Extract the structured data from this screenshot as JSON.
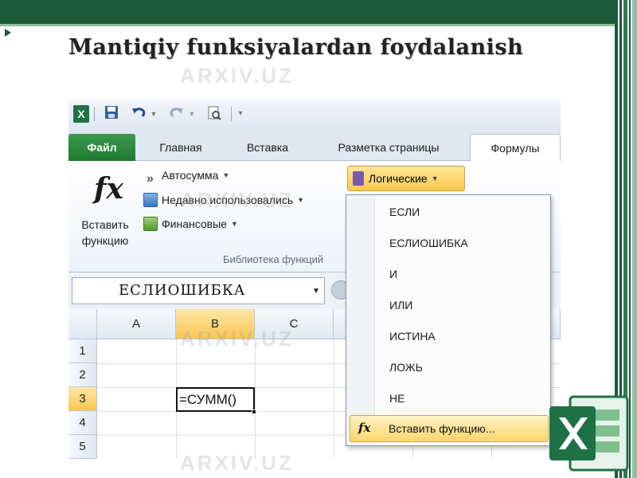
{
  "slide": {
    "title": "Mantiqiy funksiyalardan foydalanish"
  },
  "qat": {
    "logo_letter": "X",
    "icons": [
      "excel-logo-icon",
      "save-icon",
      "undo-icon",
      "redo-icon",
      "print-preview-icon",
      "customize-qat-icon"
    ]
  },
  "tabs": [
    "Файл",
    "Главная",
    "Вставка",
    "Разметка страницы",
    "Формулы"
  ],
  "ribbon": {
    "insert_function_line1": "Вставить",
    "insert_function_line2": "функцию",
    "fx_symbol": "fx",
    "autosum": "Автосумма",
    "recently_used": "Недавно использовались",
    "financial": "Финансовые",
    "logical": "Логические",
    "group_label": "Библиотека функций"
  },
  "formula_bar": {
    "name_box": "ЕСЛИОШИБКА"
  },
  "grid": {
    "columns": [
      "A",
      "B",
      "C"
    ],
    "rows": [
      "1",
      "2",
      "3",
      "4",
      "5"
    ],
    "selected_column": "B",
    "selected_row": "3",
    "active_cell_value": "=СУММ()"
  },
  "dropdown": {
    "items": [
      "ЕСЛИ",
      "ЕСЛИОШИБКА",
      "И",
      "ИЛИ",
      "ИСТИНА",
      "ЛОЖЬ",
      "НЕ"
    ],
    "insert_function": "Вставить функцию..."
  },
  "watermark": "ARXIV.UZ",
  "colors": {
    "slide_green": "#1d5a3a",
    "file_tab_green": "#1f7a31",
    "highlight_yellow": "#fbd66d",
    "excel_green": "#1e7145"
  }
}
